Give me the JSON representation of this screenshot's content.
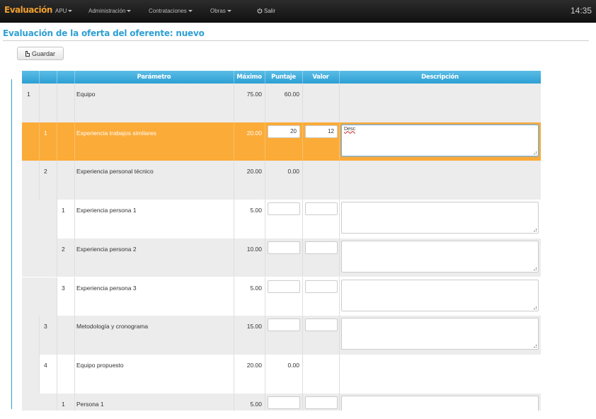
{
  "navbar": {
    "brand": "Evaluación",
    "menu": [
      {
        "label": "APU",
        "dropdown": true
      },
      {
        "label": "Administración",
        "dropdown": true
      },
      {
        "label": "Contrataciones",
        "dropdown": true
      },
      {
        "label": "Obras",
        "dropdown": true
      }
    ],
    "logout_label": "Salir",
    "logout_icon": "power-icon",
    "clock": "14:35"
  },
  "page": {
    "title": "Evaluación de la oferta del oferente: nuevo",
    "save_label": "Guardar",
    "save_icon": "document-icon"
  },
  "table": {
    "headers": {
      "parametro": "Parámetro",
      "maximo": "Máximo",
      "puntaje": "Puntaje",
      "valor": "Valor",
      "descripcion": "Descripción"
    },
    "rows": [
      {
        "n1": "1",
        "n2": "",
        "n3": "",
        "param": "Equipo",
        "max": "75.00",
        "puntaje": "60.00",
        "valor": "",
        "desc": ""
      },
      {
        "n1": "",
        "n2": "1",
        "n3": "",
        "param": "Experiencia trabajos similares",
        "max": "20.00",
        "puntaje": "20",
        "valor": "12",
        "desc": "Desc"
      },
      {
        "n1": "",
        "n2": "2",
        "n3": "",
        "param": "Experiencia personal técnico",
        "max": "20.00",
        "puntaje": "0.00",
        "valor": "",
        "desc": ""
      },
      {
        "n1": "",
        "n2": "",
        "n3": "1",
        "param": "Experiencia persona 1",
        "max": "5.00",
        "puntaje": "",
        "valor": "",
        "desc": ""
      },
      {
        "n1": "",
        "n2": "",
        "n3": "2",
        "param": "Experiencia persona 2",
        "max": "10.00",
        "puntaje": "",
        "valor": "",
        "desc": ""
      },
      {
        "n1": "",
        "n2": "",
        "n3": "3",
        "param": "Experiencia persona 3",
        "max": "5.00",
        "puntaje": "",
        "valor": "",
        "desc": ""
      },
      {
        "n1": "",
        "n2": "3",
        "n3": "",
        "param": "Metodología y cronograma",
        "max": "15.00",
        "puntaje": "",
        "valor": "",
        "desc": ""
      },
      {
        "n1": "",
        "n2": "4",
        "n3": "",
        "param": "Equipo propuesto",
        "max": "20.00",
        "puntaje": "0.00",
        "valor": "",
        "desc": ""
      },
      {
        "n1": "",
        "n2": "",
        "n3": "1",
        "param": "Persona 1",
        "max": "5.00",
        "puntaje": "",
        "valor": "",
        "desc": ""
      }
    ]
  },
  "colors": {
    "navbar": "#1b1b1b",
    "brand": "#f0a030",
    "accent": "#2f9fd3",
    "header": "#3aaddc",
    "selected_row": "#fbab38",
    "shaded_row": "#ececec"
  }
}
